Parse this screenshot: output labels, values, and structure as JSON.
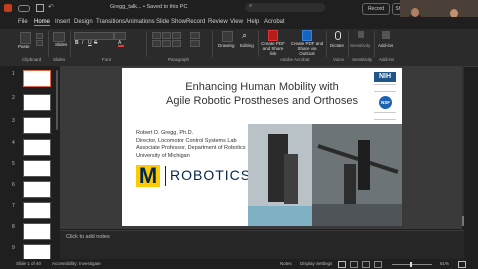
{
  "titlebar": {
    "title": "Gregg_talk... • Saved to this PC",
    "search_label": "Search",
    "record_label": "Record",
    "share_label": "Share"
  },
  "menu": [
    "File",
    "Home",
    "Insert",
    "Design",
    "Transitions",
    "Animations",
    "Slide Show",
    "Record",
    "Review",
    "View",
    "Help",
    "Acrobat"
  ],
  "ribbon": {
    "paste": "Paste",
    "slides": "Slides",
    "drawing": "Drawing",
    "editing": "Editing",
    "create_pdf_share": "Create PDF and Share link",
    "create_pdf_outlook": "Create PDF and Share via Outlook",
    "dictate": "Dictate",
    "sensitivity": "Sensitivity",
    "addins": "Add-ins",
    "groups": [
      "Clipboard",
      "Slides",
      "Font",
      "Paragraph",
      "Adobe Acrobat",
      "Voice",
      "Sensitivity",
      "Add-ins"
    ]
  },
  "thumbnails": [
    "1",
    "2",
    "3",
    "4",
    "5",
    "6",
    "7",
    "8",
    "9"
  ],
  "slide": {
    "title_line1": "Enhancing Human Mobility with",
    "title_line2": "Agile Robotic Prostheses and Orthoses",
    "author": "Robert D. Gregg, Ph.D.",
    "role1": "Director, Locomotor Control Systems Lab",
    "role2": "Associate Professor, Department of Robotics",
    "university": "University of Michigan",
    "logo_letter": "M",
    "logo_word": "ROBOTICS",
    "nih_label": "NIH",
    "nsf_label": "NSF"
  },
  "notes_placeholder": "Click to add notes",
  "status": {
    "slide_count": "Slide 1 of 40",
    "accessibility": "Accessibility: Investigate",
    "notes": "Notes",
    "display": "Display Settings",
    "zoom": "61%"
  },
  "colors": {
    "accent": "#e06c4a",
    "umich_blue": "#00274c",
    "umich_maize": "#ffcb05"
  }
}
